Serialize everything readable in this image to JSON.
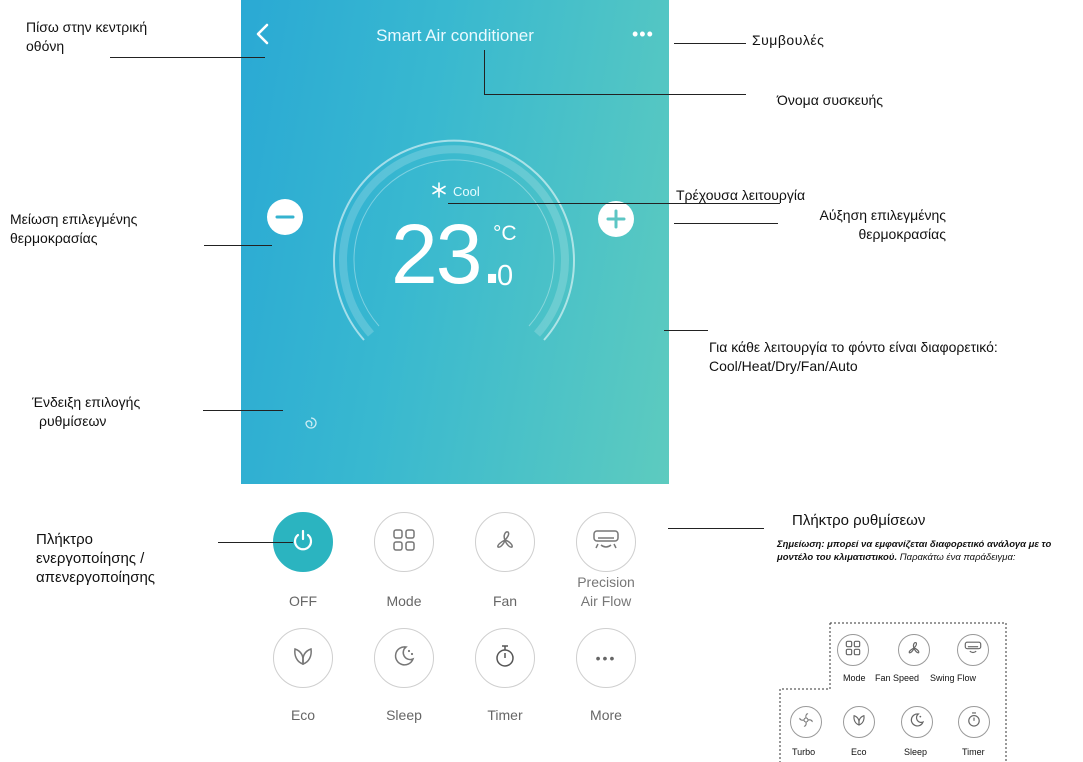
{
  "app": {
    "title": "Smart Air conditioner",
    "more_icon": "more-dots-icon",
    "back_icon": "chevron-left-icon"
  },
  "thermostat": {
    "mode_label": "Cool",
    "mode_icon": "snowflake-icon",
    "temp_integer": "23.",
    "temp_decimal": "0",
    "unit": "°C"
  },
  "controls": {
    "row1": [
      {
        "label": "OFF",
        "icon": "power-icon"
      },
      {
        "label": "Mode",
        "icon": "mode-grid-icon"
      },
      {
        "label": "Fan",
        "icon": "fan-icon"
      },
      {
        "label_line1": "Precision",
        "label_line2": "Air Flow",
        "icon": "air-flow-icon"
      }
    ],
    "row2": [
      {
        "label": "Eco",
        "icon": "leaf-icon"
      },
      {
        "label": "Sleep",
        "icon": "moon-icon"
      },
      {
        "label": "Timer",
        "icon": "stopwatch-icon"
      },
      {
        "label": "More",
        "icon": "more-dots-icon"
      }
    ]
  },
  "annotations": {
    "back": [
      "Πίσω στην κεντρική",
      "οθόνη"
    ],
    "tips": "Συμβουλές",
    "device_name": "Όνομα συσκευής",
    "current_mode": "Τρέχουσα λειτουργία",
    "decrease": [
      "Μείωση επιλεγμένης",
      "θερμοκρασίας"
    ],
    "increase": [
      "Αύξηση επιλεγμένης",
      "θερμοκρασίας"
    ],
    "background": [
      "Για κάθε λειτουργία το φόντο είναι διαφορετικό:",
      "Cool/Heat/Dry/Fan/Auto"
    ],
    "settings_indicator": [
      "Ένδειξη επιλογής",
      "ρυθμίσεων"
    ],
    "power": [
      "Πλήκτρο",
      "ενεργοποίησης /",
      "απενεργοποίησης"
    ],
    "settings_key": "Πλήκτρο ρυθμίσεων",
    "note_bold": "Σημείωση: μπορεί να εμφανίζεται διαφορετικό ανάλογα με το μοντέλο του κλιματιστικού.",
    "note_italic": "Παρακάτω ένα παράδειγμα:"
  },
  "example": {
    "row1": [
      {
        "label": "Mode",
        "icon": "mode-grid-icon"
      },
      {
        "label": "Fan Speed",
        "icon": "fan-icon"
      },
      {
        "label": "Swing Flow",
        "icon": "air-flow-icon"
      }
    ],
    "row2": [
      {
        "label": "Turbo",
        "icon": "turbo-icon"
      },
      {
        "label": "Eco",
        "icon": "leaf-icon"
      },
      {
        "label": "Sleep",
        "icon": "moon-icon"
      },
      {
        "label": "Timer",
        "icon": "stopwatch-icon"
      }
    ]
  }
}
